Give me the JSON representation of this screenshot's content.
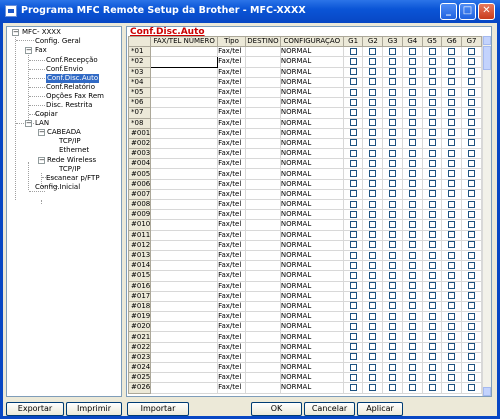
{
  "window": {
    "title": "Programa MFC Remote Setup da Brother - MFC-XXXX",
    "controls": {
      "minimize": "_",
      "maximize": "□",
      "close": "✕"
    }
  },
  "tree": {
    "root": "MFC- XXXX",
    "config_geral": "Config. Geral",
    "fax": "Fax",
    "conf_recepcao": "Conf.Recepção",
    "conf_envio": "Conf.Envio",
    "conf_disc_auto": "Conf.Disc.Auto",
    "conf_relatorio": "Conf.Relatório",
    "opcoes_fax_rem": "Opções Fax Rem",
    "disc_restrita": "Disc. Restrita",
    "copiar": "Copiar",
    "lan": "LAN",
    "cabeada": "CABEADA",
    "tcpip1": "TCP/IP",
    "ethernet": "Ethernet",
    "rede_wireless": "Rede Wireless",
    "tcpip2": "TCP/IP",
    "escanear_ftp": "Escanear p/FTP",
    "config_inicial": "Config.Inicial"
  },
  "section_title": "Conf.Disc.Auto",
  "grid": {
    "columns": {
      "fax_tel": "FAX/TEL NÚMERO",
      "tipo": "Tipo",
      "destino": "DESTINO",
      "configuracao": "CONFIGURAÇÃO",
      "g1": "G1",
      "g2": "G2",
      "g3": "G3",
      "g4": "G4",
      "g5": "G5",
      "g6": "G6",
      "g7": "G7"
    },
    "row_numbers": [
      "*01",
      "*02",
      "*03",
      "*04",
      "*05",
      "*06",
      "*07",
      "*08",
      "#001",
      "#002",
      "#003",
      "#004",
      "#005",
      "#006",
      "#007",
      "#008",
      "#009",
      "#010",
      "#011",
      "#012",
      "#013",
      "#014",
      "#015",
      "#016",
      "#017",
      "#018",
      "#019",
      "#020",
      "#021",
      "#022",
      "#023",
      "#024",
      "#025",
      "#026"
    ],
    "tipo_value": "Fax/tel",
    "config_value": "NORMAL"
  },
  "buttons": {
    "exportar": "Exportar",
    "imprimir": "Imprimir",
    "importar": "Importar",
    "ok": "OK",
    "cancelar": "Cancelar",
    "aplicar": "Aplicar"
  }
}
